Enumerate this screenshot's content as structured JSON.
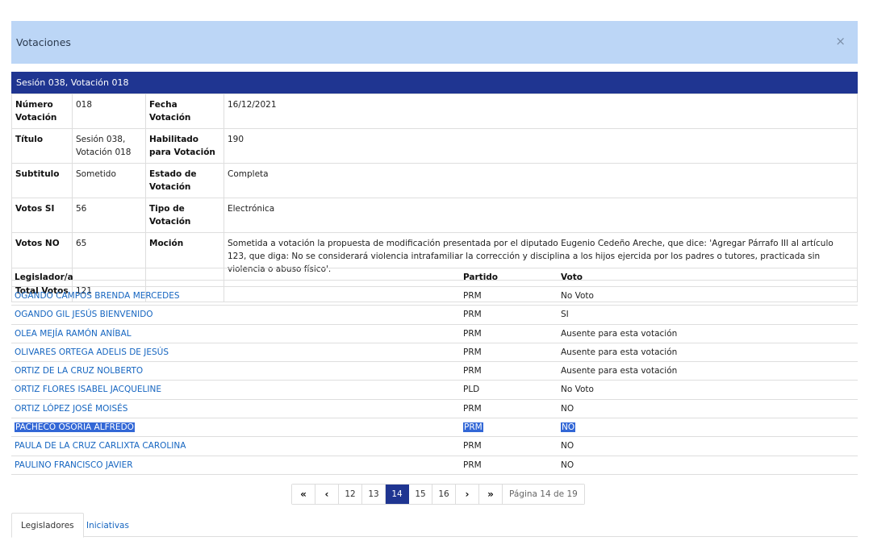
{
  "modal": {
    "title": "Votaciones",
    "close_icon": "×"
  },
  "section": {
    "title": "Sesión 038, Votación 018"
  },
  "info": {
    "numero_label": "Número Votación",
    "numero_value": "018",
    "fecha_label": "Fecha Votación",
    "fecha_value": "16/12/2021",
    "titulo_label": "Título",
    "titulo_value": "Sesión 038, Votación 018",
    "habilitado_label": "Habilitado para Votación",
    "habilitado_value": "190",
    "subtitulo_label": "Subtitulo",
    "subtitulo_value": "Sometido",
    "estado_label": "Estado de Votación",
    "estado_value": "Completa",
    "votos_si_label": "Votos SI",
    "votos_si_value": "56",
    "tipo_label": "Tipo de Votación",
    "tipo_value": "Electrónica",
    "votos_no_label": "Votos NO",
    "votos_no_value": "65",
    "mocion_label": "Moción",
    "mocion_value": "Sometida a votación la propuesta de modificación presentada por el diputado Eugenio Cedeño Areche, que dice: 'Agregar Párrafo III al artículo 123, que diga: No se considerará violencia intrafamiliar la corrección y disciplina a los hijos ejercida por los padres o tutores, practicada sin violencia o abuso físico'.",
    "total_label": "Total Votos",
    "total_value": "121"
  },
  "legisladores": {
    "headers": {
      "name": "Legislador/a",
      "party": "Partido",
      "vote": "Voto"
    },
    "rows": [
      {
        "name": "OGANDO CAMPOS BRENDA MERCEDES",
        "party": "PRM",
        "vote": "No Voto"
      },
      {
        "name": "OGANDO GIL JESÚS BIENVENIDO",
        "party": "PRM",
        "vote": "SI"
      },
      {
        "name": "OLEA MEJÍA RAMÓN ANÍBAL",
        "party": "PRM",
        "vote": "Ausente para esta votación"
      },
      {
        "name": "OLIVARES ORTEGA ADELIS DE JESÚS",
        "party": "PRM",
        "vote": "Ausente para esta votación"
      },
      {
        "name": "ORTIZ DE LA CRUZ NOLBERTO",
        "party": "PRM",
        "vote": "Ausente para esta votación"
      },
      {
        "name": "ORTIZ FLORES ISABEL JACQUELINE",
        "party": "PLD",
        "vote": "No Voto"
      },
      {
        "name": "ORTIZ LÓPEZ JOSÉ MOISÉS",
        "party": "PRM",
        "vote": "NO"
      },
      {
        "name": "PACHECO OSORIA ALFREDO",
        "party": "PRM",
        "vote": "NO"
      },
      {
        "name": "PAULA DE LA CRUZ CARLIXTA CAROLINA",
        "party": "PRM",
        "vote": "NO"
      },
      {
        "name": "PAULINO FRANCISCO JAVIER",
        "party": "PRM",
        "vote": "NO"
      }
    ]
  },
  "pagination": {
    "first_icon": "«",
    "prev_icon": "‹",
    "next_icon": "›",
    "last_icon": "»",
    "pages": [
      "12",
      "13",
      "14",
      "15",
      "16"
    ],
    "current": "14",
    "info": "Página 14 de 19"
  },
  "tabs": {
    "legisladores": "Legisladores",
    "iniciativas": "Iniciativas"
  },
  "colors": {
    "header_bg": "#bcd6f6",
    "section_bg": "#1f3591",
    "link": "#1565c0",
    "selection": "#3267d6"
  }
}
